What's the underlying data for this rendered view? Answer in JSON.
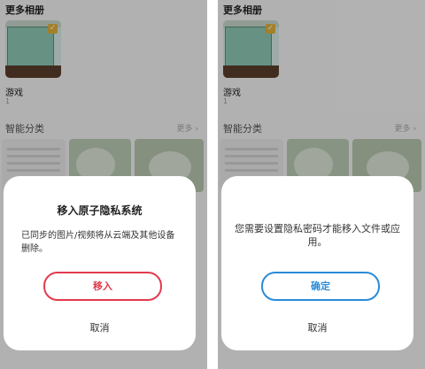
{
  "left": {
    "albums_title": "更多相册",
    "album": {
      "name": "游戏",
      "count": "1"
    },
    "smart_title": "智能分类",
    "more_label": "更多",
    "dialog": {
      "title": "移入原子隐私系统",
      "message": "已同步的图片/视频将从云端及其他设备删除。",
      "confirm_label": "移入",
      "cancel_label": "取消"
    }
  },
  "right": {
    "albums_title": "更多相册",
    "album": {
      "name": "游戏",
      "count": "1"
    },
    "smart_title": "智能分类",
    "more_label": "更多",
    "dialog": {
      "message": "您需要设置隐私密码才能移入文件或应用。",
      "confirm_label": "确定",
      "cancel_label": "取消"
    }
  },
  "colors": {
    "danger": "#e23a4c",
    "primary": "#2a8bd8"
  },
  "icons": {
    "album_selected": "checkmark-icon"
  }
}
